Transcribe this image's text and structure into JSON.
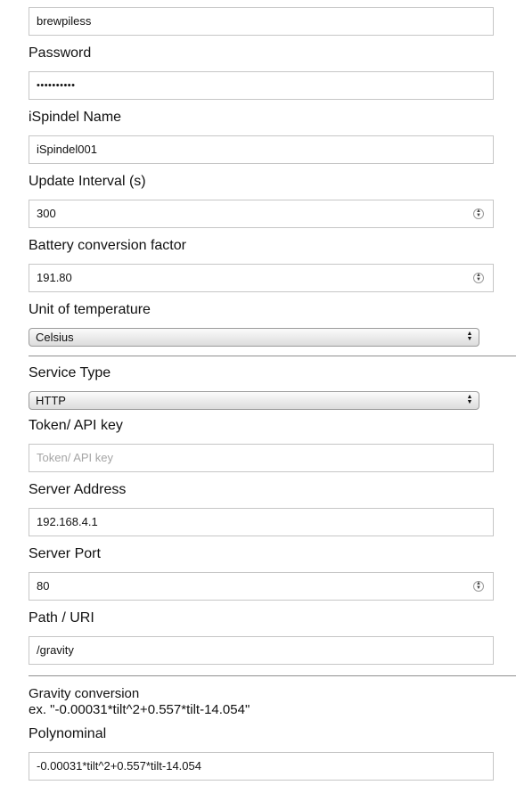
{
  "form": {
    "ssid_value": "brewpiless",
    "password_label": "Password",
    "password_value": "••••••••••",
    "name_label": "iSpindel Name",
    "name_value": "iSpindel001",
    "interval_label": "Update Interval (s)",
    "interval_value": "300",
    "battery_label": "Battery conversion factor",
    "battery_value": "191.80",
    "unit_label": "Unit of temperature",
    "unit_selected": "Celsius",
    "service_label": "Service Type",
    "service_selected": "HTTP",
    "token_label": "Token/ API key",
    "token_placeholder": "Token/ API key",
    "server_label": "Server Address",
    "server_value": "192.168.4.1",
    "port_label": "Server Port",
    "port_value": "80",
    "path_label": "Path / URI",
    "path_value": "/gravity",
    "gravity_title": "Gravity conversion",
    "gravity_example": "ex. \"-0.00031*tilt^2+0.557*tilt-14.054\"",
    "polynominal_label": "Polynominal",
    "polynominal_value": "-0.00031*tilt^2+0.557*tilt-14.054"
  }
}
